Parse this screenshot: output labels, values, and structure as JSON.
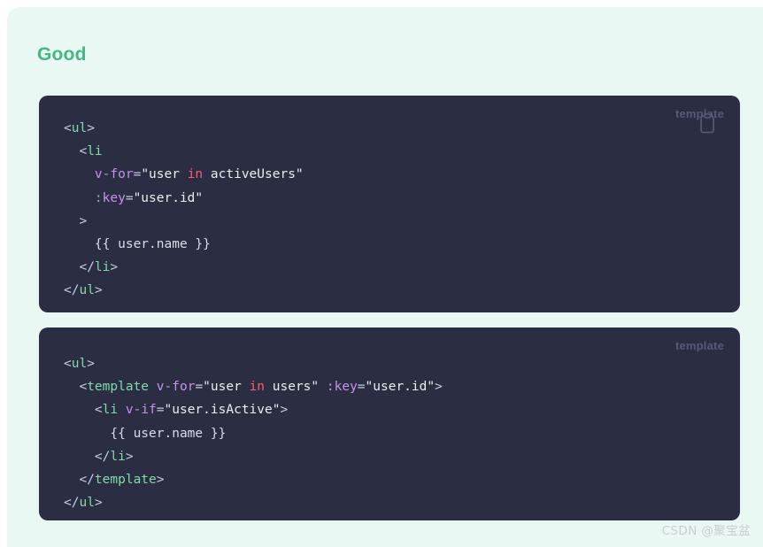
{
  "heading": {
    "text": "Good",
    "color": "#42b883"
  },
  "theme": {
    "page_background": "#ffffff",
    "panel_background": "#eaf8f3",
    "code_background": "#2b2d42",
    "code_foreground": "#d6deeb",
    "tag_color": "#7fdbac",
    "attribute_color": "#c792ea",
    "keyword_color": "#ff5874",
    "punctuation_color": "#c3cee3",
    "label_color": "#565a78",
    "watermark_color": "#c9cdd4"
  },
  "code_blocks": [
    {
      "language_label": "template",
      "has_copy_button": true,
      "copy_icon": "clipboard-copy-icon",
      "lines": [
        [
          {
            "text": "<",
            "type": "punct"
          },
          {
            "text": "ul",
            "type": "tag"
          },
          {
            "text": ">",
            "type": "punct"
          }
        ],
        [
          {
            "text": "  <",
            "type": "punct"
          },
          {
            "text": "li",
            "type": "tag"
          }
        ],
        [
          {
            "text": "    ",
            "type": "plain"
          },
          {
            "text": "v-for",
            "type": "attr"
          },
          {
            "text": "=",
            "type": "eq"
          },
          {
            "text": "\"user ",
            "type": "str"
          },
          {
            "text": "in",
            "type": "kw"
          },
          {
            "text": " activeUsers\"",
            "type": "str"
          }
        ],
        [
          {
            "text": "    ",
            "type": "plain"
          },
          {
            "text": ":key",
            "type": "attr"
          },
          {
            "text": "=",
            "type": "eq"
          },
          {
            "text": "\"user.id\"",
            "type": "str"
          }
        ],
        [
          {
            "text": "  >",
            "type": "punct"
          }
        ],
        [
          {
            "text": "    {{ user.name }}",
            "type": "mustache"
          }
        ],
        [
          {
            "text": "  </",
            "type": "punct"
          },
          {
            "text": "li",
            "type": "tag"
          },
          {
            "text": ">",
            "type": "punct"
          }
        ],
        [
          {
            "text": "</",
            "type": "punct"
          },
          {
            "text": "ul",
            "type": "tag"
          },
          {
            "text": ">",
            "type": "punct"
          }
        ]
      ]
    },
    {
      "language_label": "template",
      "has_copy_button": false,
      "copy_icon": null,
      "lines": [
        [
          {
            "text": "<",
            "type": "punct"
          },
          {
            "text": "ul",
            "type": "tag"
          },
          {
            "text": ">",
            "type": "punct"
          }
        ],
        [
          {
            "text": "  <",
            "type": "punct"
          },
          {
            "text": "template",
            "type": "tag"
          },
          {
            "text": " ",
            "type": "plain"
          },
          {
            "text": "v-for",
            "type": "attr"
          },
          {
            "text": "=",
            "type": "eq"
          },
          {
            "text": "\"user ",
            "type": "str"
          },
          {
            "text": "in",
            "type": "kw"
          },
          {
            "text": " users\"",
            "type": "str"
          },
          {
            "text": " ",
            "type": "plain"
          },
          {
            "text": ":key",
            "type": "attr"
          },
          {
            "text": "=",
            "type": "eq"
          },
          {
            "text": "\"user.id\"",
            "type": "str"
          },
          {
            "text": ">",
            "type": "punct"
          }
        ],
        [
          {
            "text": "    <",
            "type": "punct"
          },
          {
            "text": "li",
            "type": "tag"
          },
          {
            "text": " ",
            "type": "plain"
          },
          {
            "text": "v-if",
            "type": "attr"
          },
          {
            "text": "=",
            "type": "eq"
          },
          {
            "text": "\"user.isActive\"",
            "type": "str"
          },
          {
            "text": ">",
            "type": "punct"
          }
        ],
        [
          {
            "text": "      {{ user.name }}",
            "type": "mustache"
          }
        ],
        [
          {
            "text": "    </",
            "type": "punct"
          },
          {
            "text": "li",
            "type": "tag"
          },
          {
            "text": ">",
            "type": "punct"
          }
        ],
        [
          {
            "text": "  </",
            "type": "punct"
          },
          {
            "text": "template",
            "type": "tag"
          },
          {
            "text": ">",
            "type": "punct"
          }
        ],
        [
          {
            "text": "</",
            "type": "punct"
          },
          {
            "text": "ul",
            "type": "tag"
          },
          {
            "text": ">",
            "type": "punct"
          }
        ]
      ]
    }
  ],
  "watermark": {
    "text": "CSDN @聚宝盆"
  }
}
